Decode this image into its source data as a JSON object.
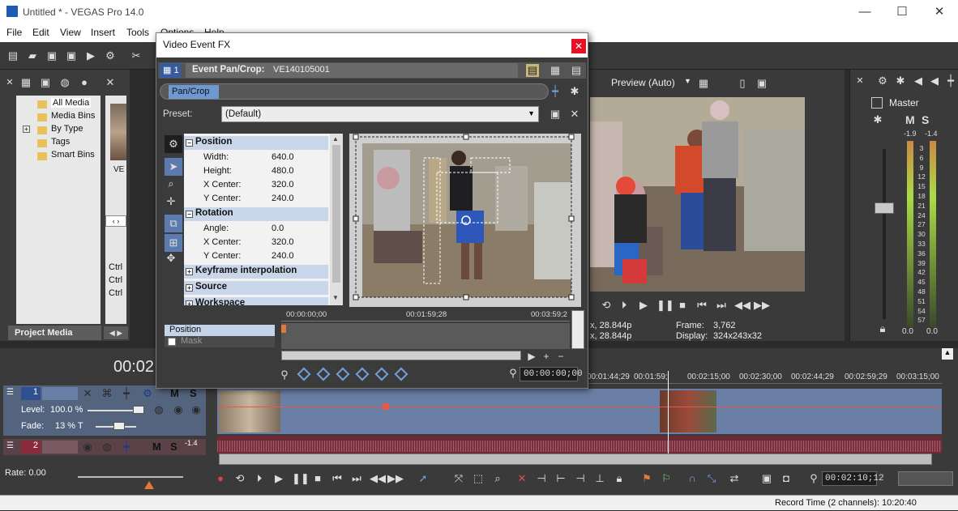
{
  "window": {
    "title": "Untitled * - VEGAS Pro 14.0"
  },
  "menu": [
    "File",
    "Edit",
    "View",
    "Insert",
    "Tools",
    "Options",
    "Help"
  ],
  "explorer": {
    "tree": [
      "All Media",
      "Media Bins",
      "By Type",
      "Tags",
      "Smart Bins"
    ],
    "tab": "Project Media",
    "thumb_label": "VE",
    "ctrl_labels": [
      "Ctrl",
      "Ctrl",
      "Ctrl"
    ]
  },
  "preview": {
    "quality": "Preview (Auto)",
    "info": [
      "x, 28.844p",
      "x, 28.844p"
    ],
    "frame_label": "Frame:",
    "frame_value": "3,762",
    "display_label": "Display:",
    "display_value": "324x243x32"
  },
  "master": {
    "label": "Master",
    "peak_left": "-1.9",
    "peak_right": "-1.4",
    "scale": [
      "3",
      "6",
      "9",
      "12",
      "15",
      "18",
      "21",
      "24",
      "27",
      "30",
      "33",
      "36",
      "39",
      "42",
      "45",
      "48",
      "51",
      "54",
      "57"
    ],
    "val_left": "0.0",
    "val_right": "0.0"
  },
  "dialog": {
    "title": "Video Event FX",
    "track_num": "1",
    "event_label": "Event Pan/Crop:",
    "event_name": "VE140105001",
    "chain_item": "Pan/Crop",
    "preset_label": "Preset:",
    "preset_value": "(Default)",
    "sections": {
      "position": "Position",
      "rotation": "Rotation",
      "keyframe": "Keyframe interpolation",
      "source": "Source",
      "workspace": "Workspace"
    },
    "position_props": [
      {
        "k": "Width:",
        "v": "640.0"
      },
      {
        "k": "Height:",
        "v": "480.0"
      },
      {
        "k": "X Center:",
        "v": "320.0"
      },
      {
        "k": "Y Center:",
        "v": "240.0"
      }
    ],
    "rotation_props": [
      {
        "k": "Angle:",
        "v": "0.0"
      },
      {
        "k": "X Center:",
        "v": "320.0"
      },
      {
        "k": "Y Center:",
        "v": "240.0"
      }
    ],
    "kf_times": [
      "00:00:00;00",
      "00:01:59;28",
      "00:03:59;2"
    ],
    "kf_rows": [
      "Position",
      "Mask"
    ],
    "kf_time": "00:00:00;00"
  },
  "timeline": {
    "big_time": "00:02",
    "track1": {
      "num": "1",
      "level_label": "Level:",
      "level_value": "100.0 %",
      "fade_label": "Fade:",
      "fade_value": "13 % T"
    },
    "track2": {
      "num": "2",
      "vol": "-1.4"
    },
    "ruler": [
      "00:01:44;29",
      "00:01:59;",
      "00:02:15;00",
      "00:02:30;00",
      "00:02:44;29",
      "00:02:59;29",
      "00:03:15;00"
    ],
    "rate": "Rate: 0.00",
    "time_box": "00:02:10;12",
    "status": "Record Time (2 channels): 10:20:40",
    "m_label": "M",
    "s_label": "S"
  }
}
